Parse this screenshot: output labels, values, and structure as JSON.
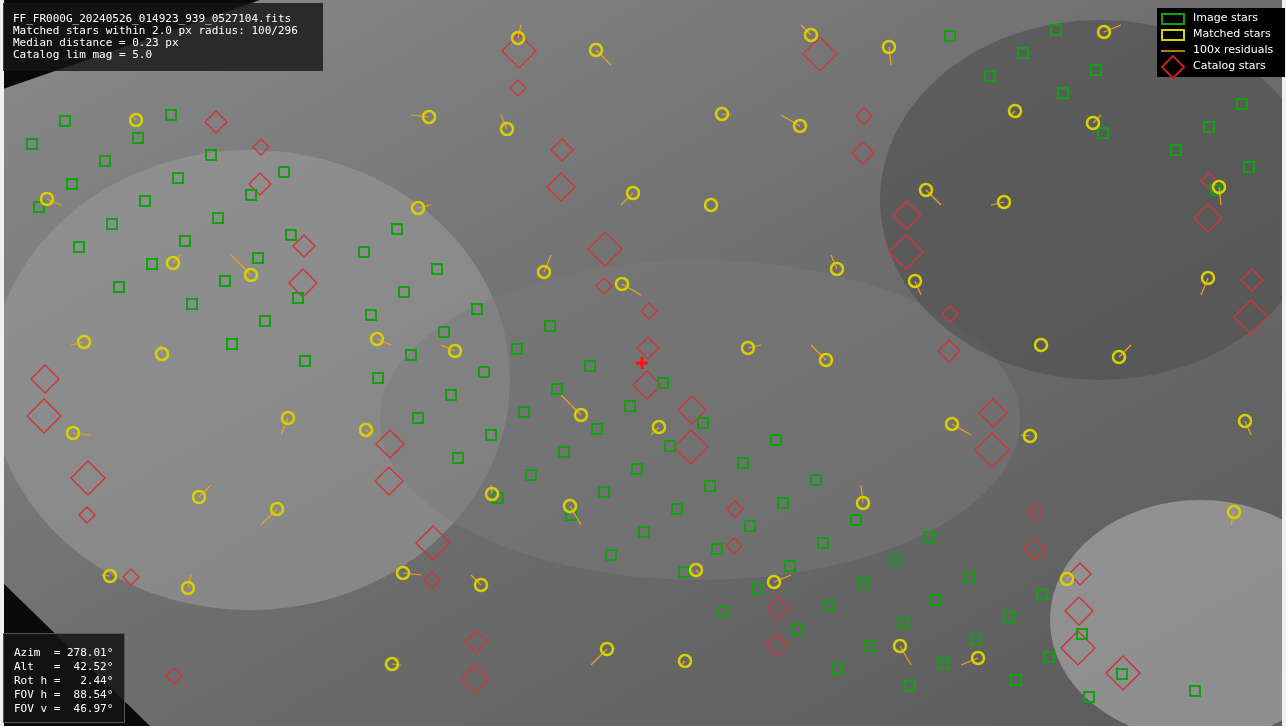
{
  "info_panel": {
    "lines": [
      "FF_FR000G_20240526_014923_939_0527104.fits",
      "Matched stars within 2.0 px radius: 100/296",
      "Median distance = 0.23 px",
      "Catalog lim mag = 5.0"
    ]
  },
  "legend": [
    {
      "label": "Image stars"
    },
    {
      "kind": "matched",
      "label": "Matched stars"
    },
    {
      "kind": "residual",
      "label": "100x residuals"
    },
    {
      "kind": "catalog",
      "label": "Catalog stars"
    }
  ],
  "pointing_panel": {
    "lines": [
      "Azim  = 278.01°",
      "Alt   =  42.52°",
      "Rot h =   2.44°",
      "FOV h =  88.54°",
      "FOV v =  46.97°"
    ]
  }
}
